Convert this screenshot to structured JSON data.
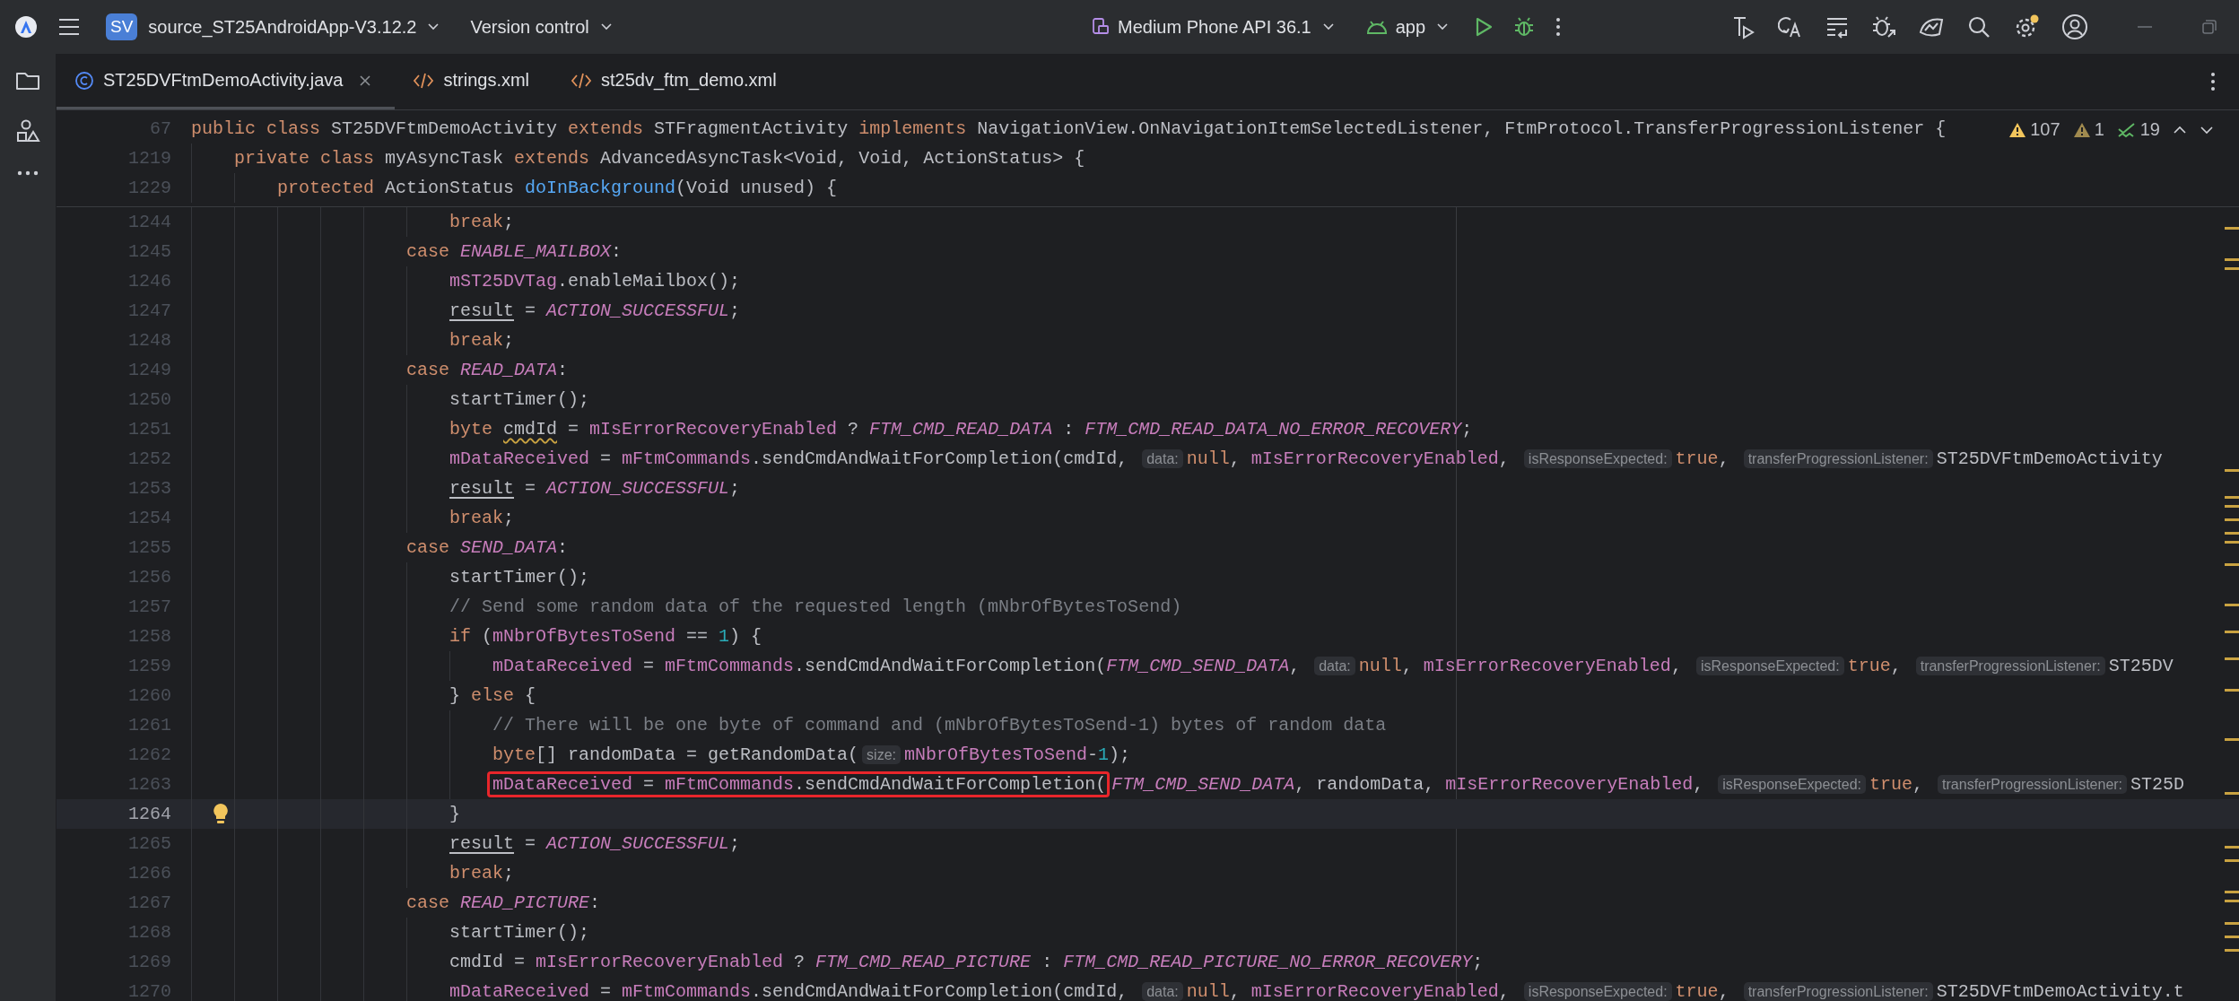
{
  "toolbar": {
    "project_badge": "SV",
    "project": "source_ST25AndroidApp-V3.12.2",
    "vcs": "Version control",
    "device": "Medium Phone API 36.1",
    "run_config": "app"
  },
  "tabs": [
    {
      "label": "ST25DVFtmDemoActivity.java",
      "kind": "java",
      "selected": true,
      "closable": true
    },
    {
      "label": "strings.xml",
      "kind": "xml",
      "selected": false,
      "closable": false
    },
    {
      "label": "st25dv_ftm_demo.xml",
      "kind": "xml",
      "selected": false,
      "closable": false
    }
  ],
  "problems": {
    "warnings": "107",
    "weak_warnings": "1",
    "typos": "19"
  },
  "sticky_lines": [
    {
      "number": "67",
      "tokens": [
        {
          "kind": "kw",
          "text": "public class "
        },
        {
          "kind": "plain",
          "text": "ST25DVFtmDemoActivity "
        },
        {
          "kind": "kw",
          "text": "extends "
        },
        {
          "kind": "plain",
          "text": "STFragmentActivity "
        },
        {
          "kind": "kw",
          "text": "implements "
        },
        {
          "kind": "plain",
          "text": "NavigationView.OnNavigationItemSelectedListener, FtmProtocol.TransferProgressionListener {"
        }
      ]
    },
    {
      "number": "1219",
      "tokens": [
        {
          "kind": "kw",
          "text": "    private class "
        },
        {
          "kind": "plain",
          "text": "myAsyncTask "
        },
        {
          "kind": "kw",
          "text": "extends "
        },
        {
          "kind": "plain",
          "text": "AdvancedAsyncTask<Void, Void, ActionStatus> {"
        }
      ]
    },
    {
      "number": "1229",
      "tokens": [
        {
          "kind": "kw",
          "text": "        protected "
        },
        {
          "kind": "plain",
          "text": "ActionStatus "
        },
        {
          "kind": "fn",
          "text": "doInBackground"
        },
        {
          "kind": "plain",
          "text": "(Void unused) {"
        }
      ]
    }
  ],
  "lines": [
    {
      "number": "1244",
      "current": false,
      "bulb": false,
      "tokens": [
        {
          "kind": "kw",
          "text": "                        break"
        },
        {
          "kind": "plain",
          "text": ";"
        }
      ]
    },
    {
      "number": "1245",
      "current": false,
      "bulb": false,
      "tokens": [
        {
          "kind": "kw",
          "text": "                    case "
        },
        {
          "kind": "const",
          "text": "ENABLE_MAILBOX"
        },
        {
          "kind": "plain",
          "text": ":"
        }
      ]
    },
    {
      "number": "1246",
      "current": false,
      "bulb": false,
      "tokens": [
        {
          "kind": "field",
          "text": "                        mST25DVTag"
        },
        {
          "kind": "plain",
          "text": ".enableMailbox();"
        }
      ]
    },
    {
      "number": "1247",
      "current": false,
      "bulb": false,
      "tokens": [
        {
          "kind": "var",
          "text": "                        result"
        },
        {
          "kind": "plain",
          "text": " = "
        },
        {
          "kind": "const",
          "text": "ACTION_SUCCESSFUL"
        },
        {
          "kind": "plain",
          "text": ";"
        }
      ]
    },
    {
      "number": "1248",
      "current": false,
      "bulb": false,
      "tokens": [
        {
          "kind": "kw",
          "text": "                        break"
        },
        {
          "kind": "plain",
          "text": ";"
        }
      ]
    },
    {
      "number": "1249",
      "current": false,
      "bulb": false,
      "tokens": [
        {
          "kind": "kw",
          "text": "                    case "
        },
        {
          "kind": "const",
          "text": "READ_DATA"
        },
        {
          "kind": "plain",
          "text": ":"
        }
      ]
    },
    {
      "number": "1250",
      "current": false,
      "bulb": false,
      "tokens": [
        {
          "kind": "plain",
          "text": "                        startTimer();"
        }
      ]
    },
    {
      "number": "1251",
      "current": false,
      "bulb": false,
      "tokens": [
        {
          "kind": "kw",
          "text": "                        byte "
        },
        {
          "kind": "warn",
          "text": "cmdId"
        },
        {
          "kind": "plain",
          "text": " = "
        },
        {
          "kind": "field",
          "text": "mIsErrorRecoveryEnabled"
        },
        {
          "kind": "plain",
          "text": " ? "
        },
        {
          "kind": "const",
          "text": "FTM_CMD_READ_DATA"
        },
        {
          "kind": "plain",
          "text": " : "
        },
        {
          "kind": "const",
          "text": "FTM_CMD_READ_DATA_NO_ERROR_RECOVERY"
        },
        {
          "kind": "plain",
          "text": ";"
        }
      ]
    },
    {
      "number": "1252",
      "current": false,
      "bulb": false,
      "tokens": [
        {
          "kind": "field",
          "text": "                        mDataReceived"
        },
        {
          "kind": "plain",
          "text": " = "
        },
        {
          "kind": "field",
          "text": "mFtmCommands"
        },
        {
          "kind": "plain",
          "text": ".sendCmdAndWaitForCompletion(cmdId, "
        },
        {
          "kind": "hint",
          "text": "data:"
        },
        {
          "kind": "kw",
          "text": "null"
        },
        {
          "kind": "plain",
          "text": ", "
        },
        {
          "kind": "field",
          "text": "mIsErrorRecoveryEnabled"
        },
        {
          "kind": "plain",
          "text": ", "
        },
        {
          "kind": "hint",
          "text": "isResponseExpected:"
        },
        {
          "kind": "kw",
          "text": "true"
        },
        {
          "kind": "plain",
          "text": ", "
        },
        {
          "kind": "hint",
          "text": "transferProgressionListener:"
        },
        {
          "kind": "plain",
          "text": "ST25DVFtmDemoActivity"
        }
      ]
    },
    {
      "number": "1253",
      "current": false,
      "bulb": false,
      "tokens": [
        {
          "kind": "var",
          "text": "                        result"
        },
        {
          "kind": "plain",
          "text": " = "
        },
        {
          "kind": "const",
          "text": "ACTION_SUCCESSFUL"
        },
        {
          "kind": "plain",
          "text": ";"
        }
      ]
    },
    {
      "number": "1254",
      "current": false,
      "bulb": false,
      "tokens": [
        {
          "kind": "kw",
          "text": "                        break"
        },
        {
          "kind": "plain",
          "text": ";"
        }
      ]
    },
    {
      "number": "1255",
      "current": false,
      "bulb": false,
      "tokens": [
        {
          "kind": "kw",
          "text": "                    case "
        },
        {
          "kind": "const",
          "text": "SEND_DATA"
        },
        {
          "kind": "plain",
          "text": ":"
        }
      ]
    },
    {
      "number": "1256",
      "current": false,
      "bulb": false,
      "tokens": [
        {
          "kind": "plain",
          "text": "                        startTimer();"
        }
      ]
    },
    {
      "number": "1257",
      "current": false,
      "bulb": false,
      "tokens": [
        {
          "kind": "comment",
          "text": "                        // Send some random data of the requested length (mNbrOfBytesToSend)"
        }
      ]
    },
    {
      "number": "1258",
      "current": false,
      "bulb": false,
      "tokens": [
        {
          "kind": "kw",
          "text": "                        if "
        },
        {
          "kind": "plain",
          "text": "("
        },
        {
          "kind": "field",
          "text": "mNbrOfBytesToSend"
        },
        {
          "kind": "plain",
          "text": " == "
        },
        {
          "kind": "num",
          "text": "1"
        },
        {
          "kind": "plain",
          "text": ") {"
        }
      ]
    },
    {
      "number": "1259",
      "current": false,
      "bulb": false,
      "tokens": [
        {
          "kind": "field",
          "text": "                            mDataReceived"
        },
        {
          "kind": "plain",
          "text": " = "
        },
        {
          "kind": "field",
          "text": "mFtmCommands"
        },
        {
          "kind": "plain",
          "text": ".sendCmdAndWaitForCompletion("
        },
        {
          "kind": "const",
          "text": "FTM_CMD_SEND_DATA"
        },
        {
          "kind": "plain",
          "text": ", "
        },
        {
          "kind": "hint",
          "text": "data:"
        },
        {
          "kind": "kw",
          "text": "null"
        },
        {
          "kind": "plain",
          "text": ", "
        },
        {
          "kind": "field",
          "text": "mIsErrorRecoveryEnabled"
        },
        {
          "kind": "plain",
          "text": ", "
        },
        {
          "kind": "hint",
          "text": "isResponseExpected:"
        },
        {
          "kind": "kw",
          "text": "true"
        },
        {
          "kind": "plain",
          "text": ", "
        },
        {
          "kind": "hint",
          "text": "transferProgressionListener:"
        },
        {
          "kind": "plain",
          "text": "ST25DV"
        }
      ]
    },
    {
      "number": "1260",
      "current": false,
      "bulb": false,
      "tokens": [
        {
          "kind": "plain",
          "text": "                        } "
        },
        {
          "kind": "kw",
          "text": "else "
        },
        {
          "kind": "plain",
          "text": "{"
        }
      ]
    },
    {
      "number": "1261",
      "current": false,
      "bulb": false,
      "tokens": [
        {
          "kind": "comment",
          "text": "                            // There will be one byte of command and (mNbrOfBytesToSend-1) bytes of random data"
        }
      ]
    },
    {
      "number": "1262",
      "current": false,
      "bulb": false,
      "tokens": [
        {
          "kind": "kw",
          "text": "                            byte"
        },
        {
          "kind": "plain",
          "text": "[] randomData = getRandomData("
        },
        {
          "kind": "hint",
          "text": "size:"
        },
        {
          "kind": "field",
          "text": "mNbrOfBytesToSend"
        },
        {
          "kind": "plain",
          "text": "-"
        },
        {
          "kind": "num",
          "text": "1"
        },
        {
          "kind": "plain",
          "text": ");"
        }
      ]
    },
    {
      "number": "1263",
      "current": false,
      "bulb": false,
      "boxed": [
        {
          "kind": "field",
          "text": "                            mDataReceived"
        },
        {
          "kind": "plain",
          "text": " = "
        },
        {
          "kind": "field",
          "text": "mFtmCommands"
        },
        {
          "kind": "plain",
          "text": ".sendCmdAndWaitForCompletion("
        }
      ],
      "tokens": [
        {
          "kind": "const",
          "text": "FTM_CMD_SEND_DATA"
        },
        {
          "kind": "plain",
          "text": ", randomData, "
        },
        {
          "kind": "field",
          "text": "mIsErrorRecoveryEnabled"
        },
        {
          "kind": "plain",
          "text": ", "
        },
        {
          "kind": "hint",
          "text": "isResponseExpected:"
        },
        {
          "kind": "kw",
          "text": "true"
        },
        {
          "kind": "plain",
          "text": ", "
        },
        {
          "kind": "hint",
          "text": "transferProgressionListener:"
        },
        {
          "kind": "plain",
          "text": "ST25D"
        }
      ]
    },
    {
      "number": "1264",
      "current": true,
      "bulb": true,
      "tokens": [
        {
          "kind": "plain",
          "text": "                        }"
        }
      ]
    },
    {
      "number": "1265",
      "current": false,
      "bulb": false,
      "tokens": [
        {
          "kind": "var",
          "text": "                        result"
        },
        {
          "kind": "plain",
          "text": " = "
        },
        {
          "kind": "const",
          "text": "ACTION_SUCCESSFUL"
        },
        {
          "kind": "plain",
          "text": ";"
        }
      ]
    },
    {
      "number": "1266",
      "current": false,
      "bulb": false,
      "tokens": [
        {
          "kind": "kw",
          "text": "                        break"
        },
        {
          "kind": "plain",
          "text": ";"
        }
      ]
    },
    {
      "number": "1267",
      "current": false,
      "bulb": false,
      "tokens": [
        {
          "kind": "kw",
          "text": "                    case "
        },
        {
          "kind": "const",
          "text": "READ_PICTURE"
        },
        {
          "kind": "plain",
          "text": ":"
        }
      ]
    },
    {
      "number": "1268",
      "current": false,
      "bulb": false,
      "tokens": [
        {
          "kind": "plain",
          "text": "                        startTimer();"
        }
      ]
    },
    {
      "number": "1269",
      "current": false,
      "bulb": false,
      "tokens": [
        {
          "kind": "plain",
          "text": "                        cmdId = "
        },
        {
          "kind": "field",
          "text": "mIsErrorRecoveryEnabled"
        },
        {
          "kind": "plain",
          "text": " ? "
        },
        {
          "kind": "const",
          "text": "FTM_CMD_READ_PICTURE"
        },
        {
          "kind": "plain",
          "text": " : "
        },
        {
          "kind": "const",
          "text": "FTM_CMD_READ_PICTURE_NO_ERROR_RECOVERY"
        },
        {
          "kind": "plain",
          "text": ";"
        }
      ]
    },
    {
      "number": "1270",
      "current": false,
      "bulb": false,
      "tokens": [
        {
          "kind": "field",
          "text": "                        mDataReceived"
        },
        {
          "kind": "plain",
          "text": " = "
        },
        {
          "kind": "field",
          "text": "mFtmCommands"
        },
        {
          "kind": "plain",
          "text": ".sendCmdAndWaitForCompletion(cmdId, "
        },
        {
          "kind": "hint",
          "text": "data:"
        },
        {
          "kind": "kw",
          "text": "null"
        },
        {
          "kind": "plain",
          "text": ", "
        },
        {
          "kind": "field",
          "text": "mIsErrorRecoveryEnabled"
        },
        {
          "kind": "plain",
          "text": ", "
        },
        {
          "kind": "hint",
          "text": "isResponseExpected:"
        },
        {
          "kind": "kw",
          "text": "true"
        },
        {
          "kind": "plain",
          "text": ", "
        },
        {
          "kind": "hint",
          "text": "transferProgressionListener:"
        },
        {
          "kind": "plain",
          "text": "ST25DVFtmDemoActivity.t"
        }
      ]
    }
  ]
}
